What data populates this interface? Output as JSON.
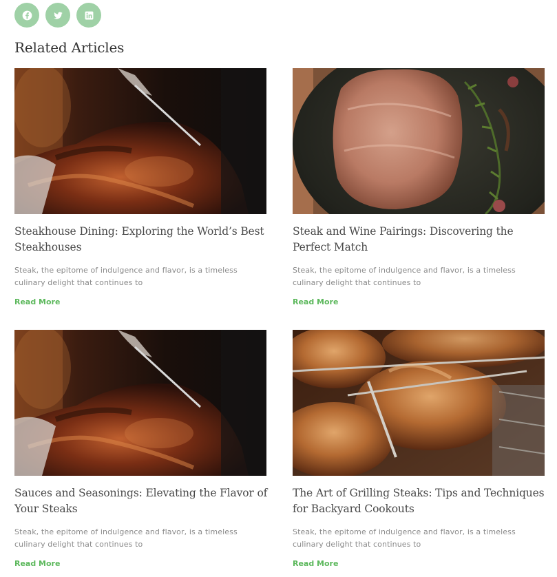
{
  "share": {
    "buttons": [
      {
        "icon": "facebook-icon"
      },
      {
        "icon": "twitter-icon"
      },
      {
        "icon": "linkedin-icon"
      }
    ],
    "color": "#9fd1a6"
  },
  "related": {
    "heading": "Related Articles",
    "accent_color": "#5cb85c",
    "articles": [
      {
        "title": "Steakhouse Dining: Exploring the World’s Best Steakhouses",
        "excerpt": "Steak, the epitome of indulgence and flavor, is a timeless culinary delight that continues to",
        "read_more": "Read More",
        "image": "carved-roast-photo"
      },
      {
        "title": "Steak and Wine Pairings: Discovering the Perfect Match",
        "excerpt": "Steak, the epitome of indulgence and flavor, is a timeless culinary delight that continues to",
        "read_more": "Read More",
        "image": "steak-in-pan-photo"
      },
      {
        "title": "Sauces and Seasonings: Elevating the Flavor of Your Steaks",
        "excerpt": "Steak, the epitome of indulgence and flavor, is a timeless culinary delight that continues to",
        "read_more": "Read More",
        "image": "carved-roast-photo"
      },
      {
        "title": "The Art of Grilling Steaks: Tips and Techniques for Backyard Cookouts",
        "excerpt": "Steak, the epitome of indulgence and flavor, is a timeless culinary delight that continues to",
        "read_more": "Read More",
        "image": "rotisserie-meat-photo"
      }
    ]
  }
}
